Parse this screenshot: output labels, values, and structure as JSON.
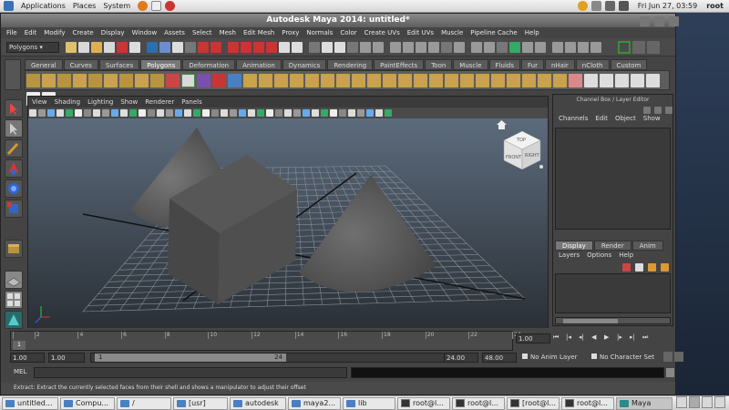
{
  "top_panel": {
    "menus": [
      "Applications",
      "Places",
      "System"
    ],
    "clock": "Fri Jun 27, 03:59",
    "user": "root"
  },
  "window": {
    "title": "Autodesk Maya 2014: untitled*"
  },
  "main_menu": [
    "File",
    "Edit",
    "Modify",
    "Create",
    "Display",
    "Window",
    "Assets",
    "Select",
    "Mesh",
    "Edit Mesh",
    "Proxy",
    "Normals",
    "Color",
    "Create UVs",
    "Edit UVs",
    "Muscle",
    "Pipeline Cache",
    "Help"
  ],
  "status_line": {
    "menu_set": "Polygons"
  },
  "shelf_tabs": [
    "General",
    "Curves",
    "Surfaces",
    "Polygons",
    "Deformation",
    "Animation",
    "Dynamics",
    "Rendering",
    "PaintEffects",
    "Toon",
    "Muscle",
    "Fluids",
    "Fur",
    "nHair",
    "nCloth",
    "Custom"
  ],
  "active_shelf_tab": "Polygons",
  "viewport": {
    "menu": [
      "View",
      "Shading",
      "Lighting",
      "Show",
      "Renderer",
      "Panels"
    ],
    "viewcube": {
      "top": "TOP",
      "front": "FRONT",
      "right": "RIGHT"
    }
  },
  "channel_box": {
    "title": "Channel Box / Layer Editor",
    "menu": [
      "Channels",
      "Edit",
      "Object",
      "Show"
    ],
    "layer_tabs": [
      "Display",
      "Render",
      "Anim"
    ],
    "active_layer_tab": "Display",
    "layer_menu": [
      "Layers",
      "Options",
      "Help"
    ]
  },
  "time_slider": {
    "ticks": [
      1,
      2,
      4,
      6,
      8,
      10,
      12,
      14,
      16,
      18,
      20,
      22,
      24
    ],
    "current_frame": "1",
    "current_time": "1.00"
  },
  "range_slider": {
    "start_time": "1.00",
    "playback_start": "1.00",
    "range_start": "1",
    "range_end": "24",
    "playback_end": "24.00",
    "end_time": "48.00",
    "anim_layer": "No Anim Layer",
    "character_set": "No Character Set"
  },
  "command_line": {
    "label": "MEL"
  },
  "help_line": "Extract: Extract the currently selected faces from their shell and shows a manipulator to adjust their offset",
  "taskbar": [
    {
      "label": "untitled...",
      "icon": "folder-icon"
    },
    {
      "label": "Compu...",
      "icon": "folder-icon"
    },
    {
      "label": "/",
      "icon": "folder-icon"
    },
    {
      "label": "[usr]",
      "icon": "folder-icon"
    },
    {
      "label": "autodesk",
      "icon": "folder-icon"
    },
    {
      "label": "maya2...",
      "icon": "folder-icon"
    },
    {
      "label": "lib",
      "icon": "folder-icon"
    },
    {
      "label": "root@l...",
      "icon": "terminal-icon"
    },
    {
      "label": "root@l...",
      "icon": "terminal-icon"
    },
    {
      "label": "[root@l...",
      "icon": "terminal-icon"
    },
    {
      "label": "root@l...",
      "icon": "terminal-icon"
    },
    {
      "label": "Maya",
      "icon": "maya-icon"
    }
  ],
  "colors": {
    "maya_bg": "#444444",
    "viewport_top": "#5c6b7c",
    "viewport_bottom": "#2a3036",
    "accent_green": "#3a8f3a"
  }
}
